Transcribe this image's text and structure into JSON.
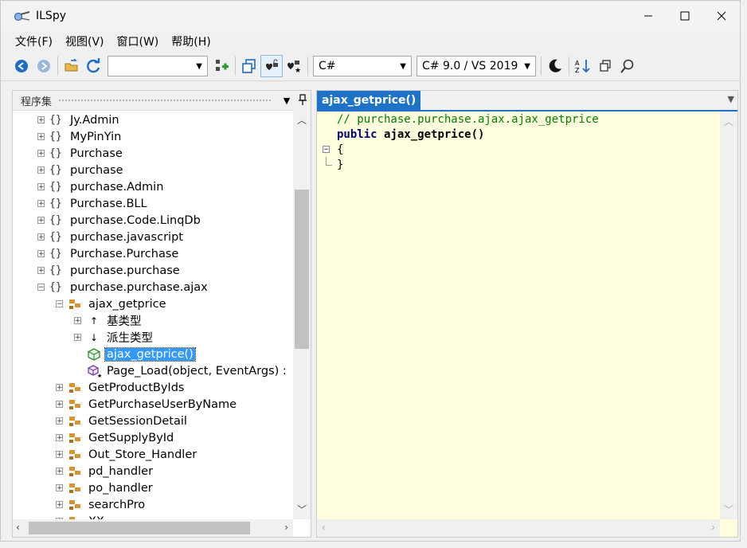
{
  "window": {
    "title": "ILSpy"
  },
  "menu": [
    "文件(F)",
    "视图(V)",
    "窗口(W)",
    "帮助(H)"
  ],
  "toolbar": {
    "assembly_list_value": "",
    "language_value": "C#",
    "language_version_value": "C# 9.0 / VS 2019"
  },
  "left_panel": {
    "title": "程序集",
    "rows": [
      {
        "label": "Jy.Admin"
      },
      {
        "label": "MyPinYin"
      },
      {
        "label": "Purchase"
      },
      {
        "label": "purchase"
      },
      {
        "label": "purchase.Admin"
      },
      {
        "label": "Purchase.BLL"
      },
      {
        "label": "purchase.Code.LinqDb"
      },
      {
        "label": "purchase.javascript"
      },
      {
        "label": "Purchase.Purchase"
      },
      {
        "label": "purchase.purchase"
      },
      {
        "label": "purchase.purchase.ajax"
      },
      {
        "label": "ajax_getprice"
      },
      {
        "label": "基类型"
      },
      {
        "label": "派生类型"
      },
      {
        "label": "ajax_getprice()"
      },
      {
        "label": "Page_Load(object, EventArgs) :"
      },
      {
        "label": "GetProductByIds"
      },
      {
        "label": "GetPurchaseUserByName"
      },
      {
        "label": "GetSessionDetail"
      },
      {
        "label": "GetSupplyById"
      },
      {
        "label": "Out_Store_Handler"
      },
      {
        "label": "pd_handler"
      },
      {
        "label": "po_handler"
      },
      {
        "label": "searchPro"
      },
      {
        "label": "XX"
      }
    ]
  },
  "editor": {
    "tab_label": "ajax_getprice()",
    "comment": "// purchase.purchase.ajax.ajax_getprice",
    "keyword": "public",
    "signature": "ajax_getprice()",
    "open_brace": "{",
    "close_brace": "}"
  },
  "stray_text": "x"
}
